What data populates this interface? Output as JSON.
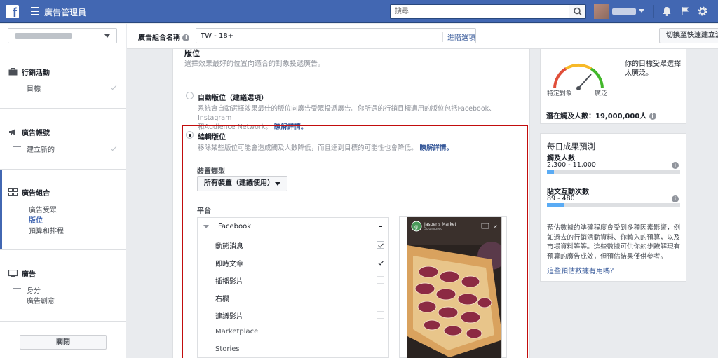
{
  "colors": {
    "brand": "#4267b2",
    "highlight_frame": "#c20d0d",
    "bar_fill": "#5aabf4"
  },
  "topbar": {
    "app_title": "廣告管理員",
    "search_placeholder": "搜尋",
    "icons": [
      "facebook-logo-icon",
      "menu-icon",
      "search-icon",
      "bell-icon",
      "flag-icon",
      "gear-icon"
    ]
  },
  "sidebar": {
    "sections": [
      {
        "title": "行銷活動",
        "items": [
          "目標"
        ],
        "icon": "briefcase-icon"
      },
      {
        "title": "廣告帳號",
        "items": [
          "建立新的"
        ],
        "icon": "megaphone-icon"
      },
      {
        "title": "廣告組合",
        "items": [
          "廣告受眾",
          "版位",
          "預算和排程"
        ],
        "icon": "grid-icon"
      },
      {
        "title": "廣告",
        "items": [
          "身分",
          "廣告創意"
        ],
        "icon": "monitor-icon"
      }
    ],
    "close_label": "關閉"
  },
  "namebar": {
    "label": "廣告組合名稱",
    "value": "TW - 18+",
    "advanced_link": "進階選項",
    "quick_create": "切換至快速建立流程"
  },
  "placement": {
    "title": "版位",
    "description": "選擇效果最好的位置向適合的對象投遞廣告。",
    "auto": {
      "title": "自動版位（建議選項）",
      "desc_line1": "系統會自動選擇效果最佳的版位向廣告受眾投遞廣告。你所選的行銷目標適用的版位包括Facebook、Instagram",
      "desc_line2": "和Audience Network。",
      "learn_more": "瞭解詳情。"
    },
    "edit": {
      "title": "編輯版位",
      "desc": "移除某些版位可能會造成觸及人數降低，而且達到目標的可能性也會降低。",
      "learn_more": "瞭解詳情。"
    },
    "device_label": "裝置類型",
    "device_value": "所有裝置（建議使用）",
    "platform_label": "平台",
    "platform_name": "Facebook",
    "platform_items": [
      {
        "label": "動態消息",
        "checked": true
      },
      {
        "label": "即時文章",
        "checked": true
      },
      {
        "label": "插播影片",
        "checked": false
      },
      {
        "label": "右欄",
        "checked": null
      },
      {
        "label": "建議影片",
        "checked": false
      },
      {
        "label": "Marketplace",
        "checked": null
      },
      {
        "label": "Stories",
        "checked": null
      }
    ],
    "preview": {
      "page_name": "Jasper's Market",
      "sub": "Sponsored"
    }
  },
  "audience": {
    "specific": "特定對象",
    "broad": "廣泛",
    "summary": "你的目標受眾選擇太廣泛。",
    "potential_reach": "潛在觸及人數：19,000,000人"
  },
  "estimate": {
    "title": "每日成果預測",
    "reach_label": "觸及人數",
    "reach_value": "2,300 - 11,000",
    "reach_fill": 0.05,
    "engage_label": "貼文互動次數",
    "engage_value": "89 - 480",
    "engage_fill": 0.13,
    "description": "預估數據的準確程度會受到多種因素影響，例如過去的行銷活動資料、你輸入的預算，以及市場資料等等。這些數據可供你約步瞭解現有預算的廣告成效，但預估結果僅供參考。",
    "helpful_link": "這些預估數據有用嗎？"
  }
}
